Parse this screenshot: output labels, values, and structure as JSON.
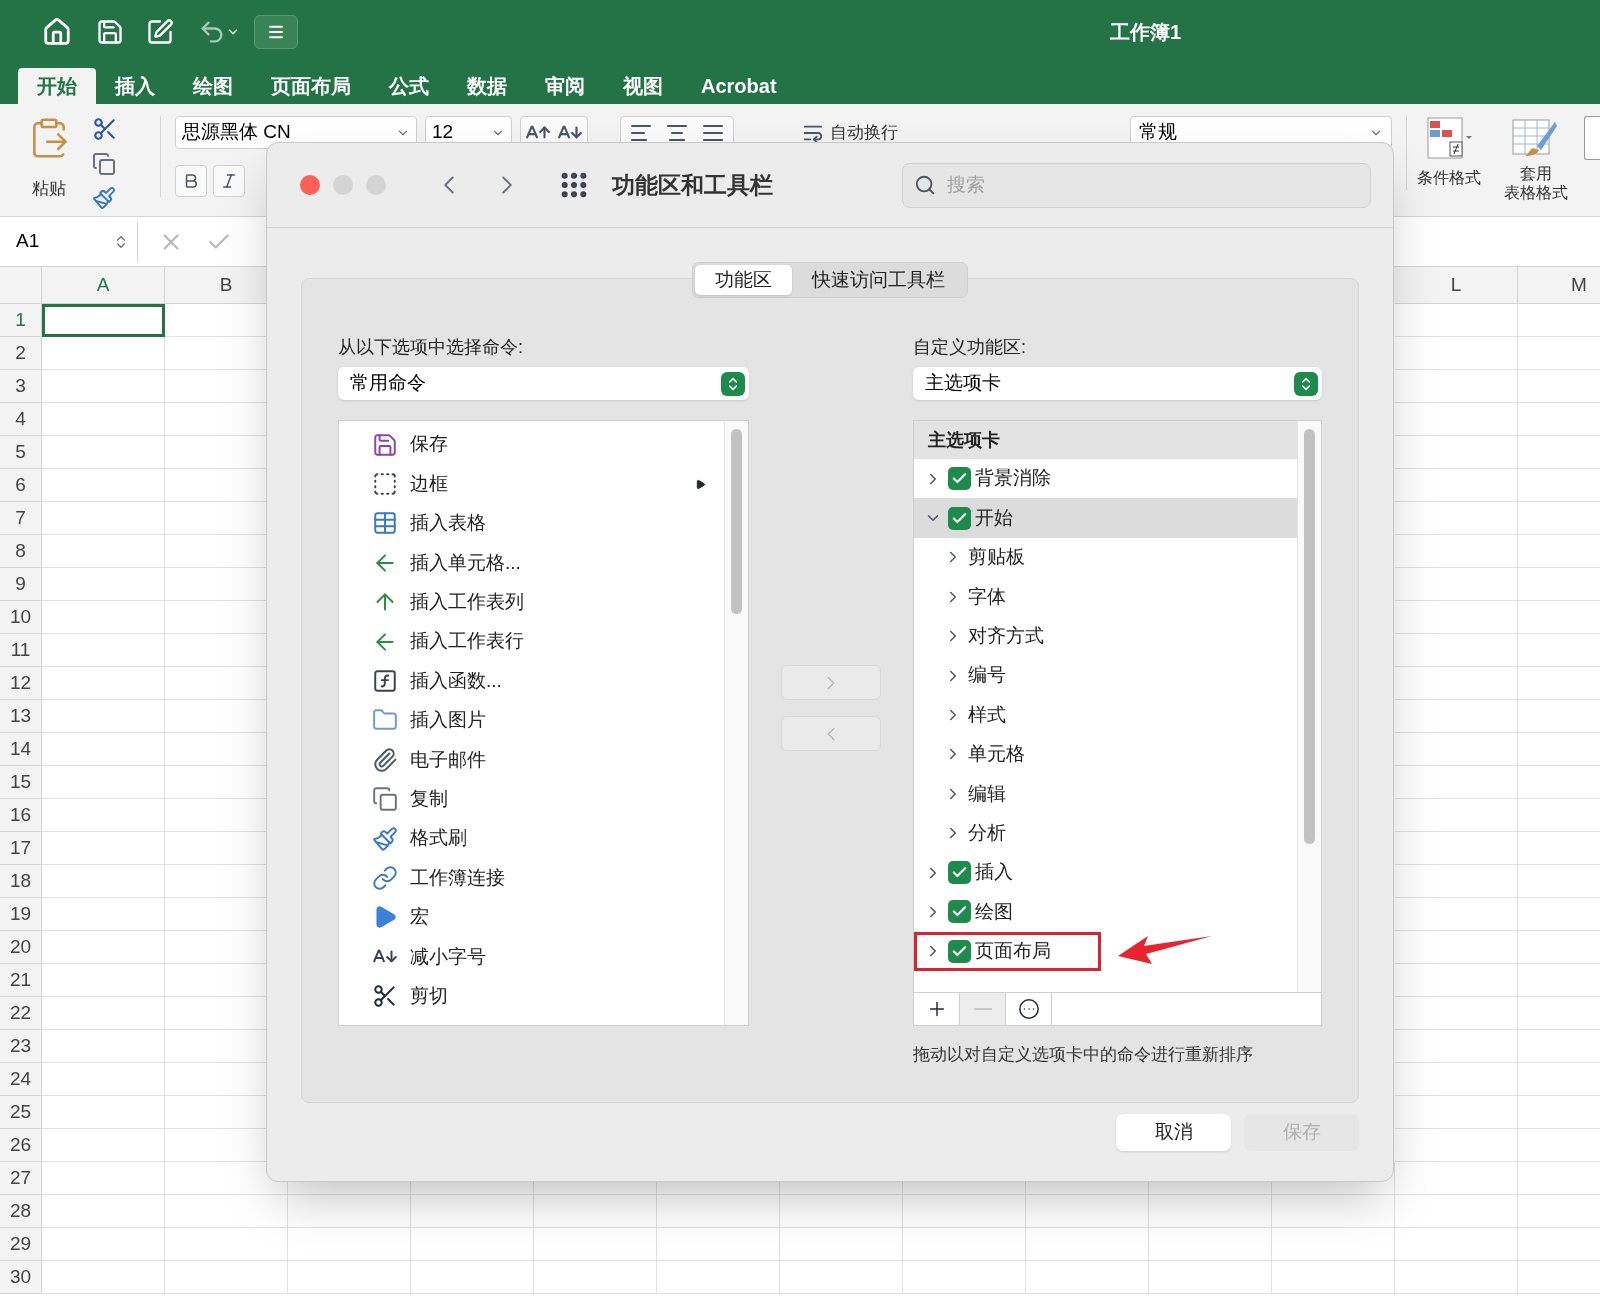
{
  "app": {
    "title": "工作簿1",
    "ribbon_tabs": [
      {
        "label": "开始",
        "selected": true
      },
      {
        "label": "插入",
        "selected": false
      },
      {
        "label": "绘图",
        "selected": false
      },
      {
        "label": "页面布局",
        "selected": false
      },
      {
        "label": "公式",
        "selected": false
      },
      {
        "label": "数据",
        "selected": false
      },
      {
        "label": "审阅",
        "selected": false
      },
      {
        "label": "视图",
        "selected": false
      },
      {
        "label": "Acrobat",
        "selected": false
      }
    ]
  },
  "ribbon": {
    "paste_label": "粘贴",
    "font_name": "思源黑体 CN",
    "font_size": "12",
    "wrap_text": "自动换行",
    "number_format": "常规",
    "conditional_format": "条件格式",
    "table_format": [
      "套用",
      "表格格式"
    ]
  },
  "formula_bar": {
    "name_box": "A1"
  },
  "sheet": {
    "columns": [
      {
        "label": "A",
        "selected": true
      },
      {
        "label": "B",
        "selected": false
      },
      {
        "label": "L",
        "selected": false
      },
      {
        "label": "M",
        "selected": false
      }
    ],
    "rows": [
      {
        "label": "1",
        "selected": true
      },
      {
        "label": "2",
        "selected": false
      },
      {
        "label": "3",
        "selected": false
      },
      {
        "label": "4",
        "selected": false
      },
      {
        "label": "5",
        "selected": false
      },
      {
        "label": "6",
        "selected": false
      },
      {
        "label": "7",
        "selected": false
      },
      {
        "label": "8",
        "selected": false
      },
      {
        "label": "9",
        "selected": false
      },
      {
        "label": "10",
        "selected": false
      },
      {
        "label": "11",
        "selected": false
      },
      {
        "label": "12",
        "selected": false
      },
      {
        "label": "13",
        "selected": false
      },
      {
        "label": "14",
        "selected": false
      },
      {
        "label": "15",
        "selected": false
      },
      {
        "label": "16",
        "selected": false
      },
      {
        "label": "17",
        "selected": false
      },
      {
        "label": "18",
        "selected": false
      },
      {
        "label": "19",
        "selected": false
      },
      {
        "label": "20",
        "selected": false
      },
      {
        "label": "21",
        "selected": false
      },
      {
        "label": "22",
        "selected": false
      },
      {
        "label": "23",
        "selected": false
      },
      {
        "label": "24",
        "selected": false
      },
      {
        "label": "25",
        "selected": false
      },
      {
        "label": "26",
        "selected": false
      },
      {
        "label": "27",
        "selected": false
      },
      {
        "label": "28",
        "selected": false
      },
      {
        "label": "29",
        "selected": false
      },
      {
        "label": "30",
        "selected": false
      }
    ]
  },
  "dialog": {
    "title": "功能区和工具栏",
    "window_buttons": [
      {
        "kind": "close"
      },
      {
        "kind": "minimize"
      },
      {
        "kind": "zoom"
      }
    ],
    "search_placeholder": "搜索",
    "segments": [
      {
        "label": "功能区",
        "selected": true
      },
      {
        "label": "快速访问工具栏",
        "selected": false
      }
    ],
    "left": {
      "label": "从以下选项中选择命令:",
      "dropdown": "常用命令",
      "commands": [
        {
          "label": "保存",
          "submenu": false
        },
        {
          "label": "边框",
          "submenu": true
        },
        {
          "label": "插入表格",
          "submenu": false
        },
        {
          "label": "插入单元格...",
          "submenu": false
        },
        {
          "label": "插入工作表列",
          "submenu": false
        },
        {
          "label": "插入工作表行",
          "submenu": false
        },
        {
          "label": "插入函数...",
          "submenu": false
        },
        {
          "label": "插入图片",
          "submenu": false
        },
        {
          "label": "电子邮件",
          "submenu": false
        },
        {
          "label": "复制",
          "submenu": false
        },
        {
          "label": "格式刷",
          "submenu": false
        },
        {
          "label": "工作簿连接",
          "submenu": false
        },
        {
          "label": "宏",
          "submenu": false
        },
        {
          "label": "减小字号",
          "submenu": false
        },
        {
          "label": "剪切",
          "submenu": false
        }
      ]
    },
    "move_buttons": [
      {
        "kind": "add",
        "disabled": true
      },
      {
        "kind": "remove",
        "disabled": true
      }
    ],
    "right": {
      "label": "自定义功能区:",
      "dropdown": "主选项卡",
      "tree_header": "主选项卡",
      "tabs": [
        {
          "label": "背景消除",
          "checked": true,
          "expanded": false,
          "selected": false,
          "annotated": false
        },
        {
          "label": "开始",
          "checked": true,
          "expanded": true,
          "selected": true,
          "annotated": false,
          "children": [
            {
              "label": "剪贴板",
              "selected": false
            },
            {
              "label": "字体",
              "selected": false
            },
            {
              "label": "对齐方式",
              "selected": false
            },
            {
              "label": "编号",
              "selected": false
            },
            {
              "label": "样式",
              "selected": false
            },
            {
              "label": "单元格",
              "selected": false
            },
            {
              "label": "编辑",
              "selected": false
            },
            {
              "label": "分析",
              "selected": false
            }
          ]
        },
        {
          "label": "插入",
          "checked": true,
          "expanded": false,
          "selected": false,
          "annotated": false
        },
        {
          "label": "绘图",
          "checked": true,
          "expanded": false,
          "selected": false,
          "annotated": false
        },
        {
          "label": "页面布局",
          "checked": true,
          "expanded": false,
          "selected": false,
          "annotated": true
        }
      ],
      "toolbar": [
        {
          "kind": "add",
          "disabled": false
        },
        {
          "kind": "remove",
          "disabled": true
        },
        {
          "kind": "more",
          "disabled": false
        }
      ],
      "hint": "拖动以对自定义选项卡中的命令进行重新排序"
    },
    "buttons": [
      {
        "label": "取消",
        "disabled": false
      },
      {
        "label": "保存",
        "disabled": true
      }
    ]
  }
}
